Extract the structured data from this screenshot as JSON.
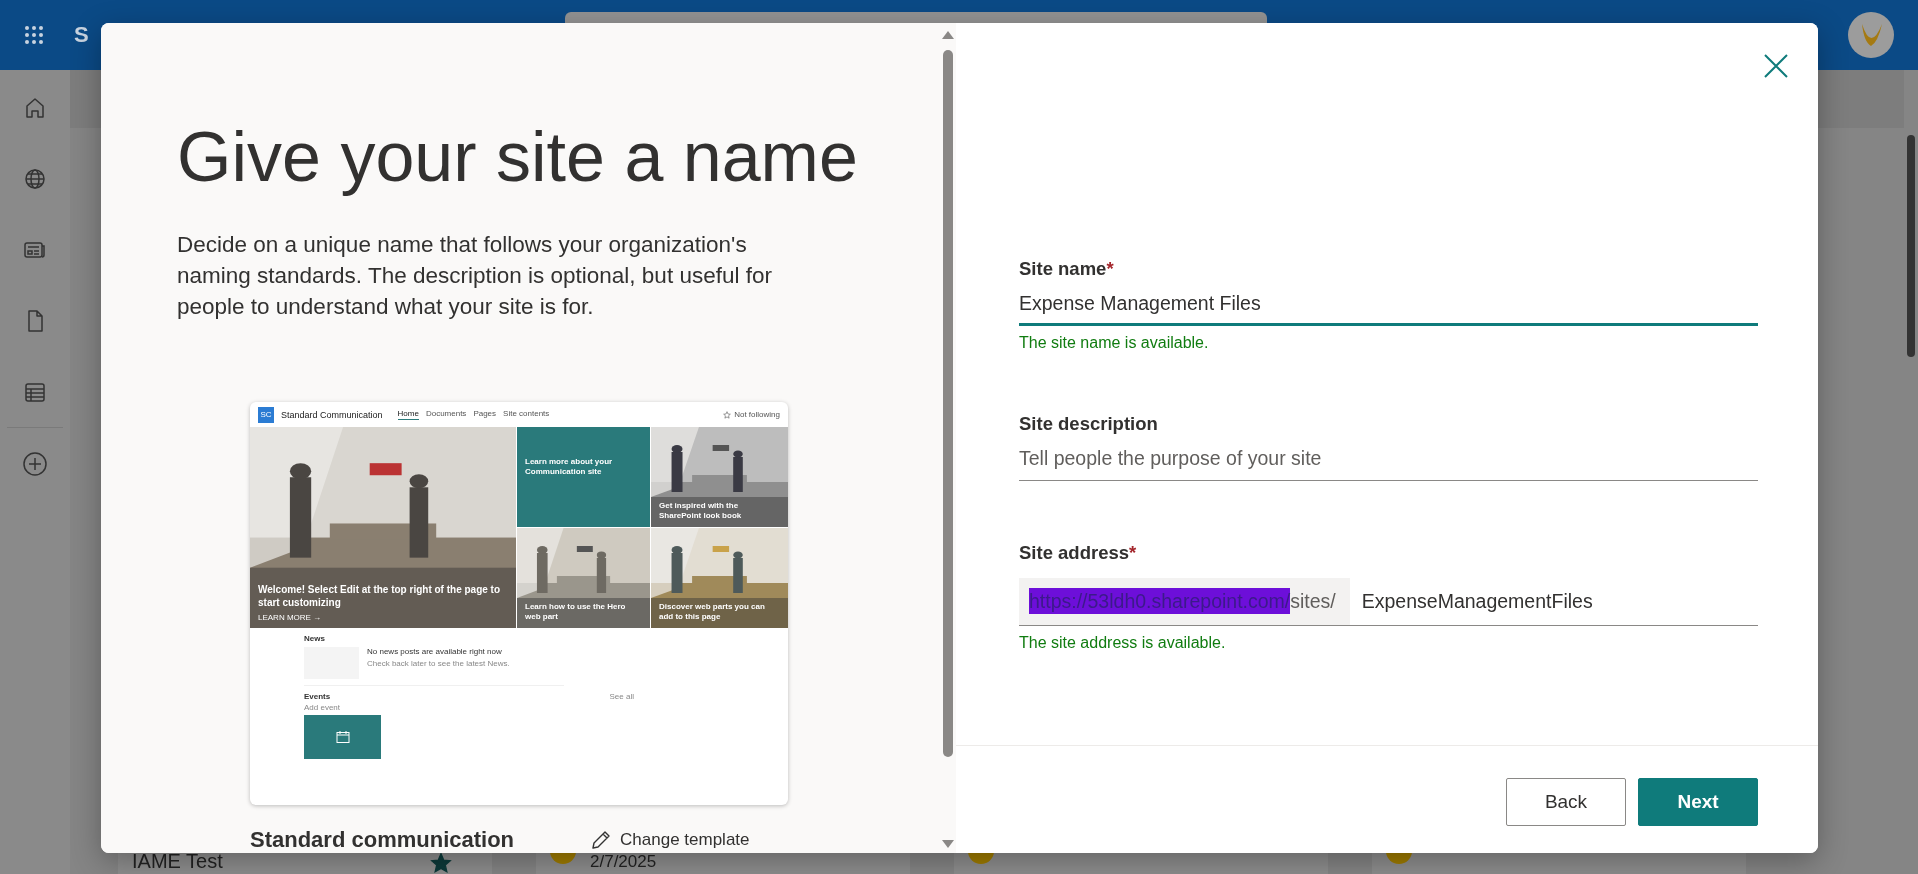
{
  "app_bar": {
    "title_fragment": "S"
  },
  "background_cards": [
    {
      "kind": "site",
      "title": "IAME Test",
      "starred": true
    },
    {
      "kind": "news",
      "date": "2/7/2025"
    },
    {
      "kind": "news"
    },
    {
      "kind": "news"
    }
  ],
  "dialog": {
    "title": "Give your site a name",
    "description": "Decide on a unique name that follows your organization's naming standards. The description is optional, but useful for people to understand what your site is for.",
    "template_preview": {
      "logo": "SC",
      "site_title": "Standard Communication",
      "nav": [
        {
          "label": "Home",
          "selected": true
        },
        {
          "label": "Documents",
          "selected": false
        },
        {
          "label": "Pages",
          "selected": false
        },
        {
          "label": "Site contents",
          "selected": false
        }
      ],
      "follow": "Not following",
      "hero": [
        {
          "text": "Welcome! Select Edit at the top right of the page to start customizing",
          "link": "LEARN MORE →"
        },
        {
          "kind": "color",
          "text": "Learn more about your Communication site"
        },
        {
          "text": "Get inspired with the SharePoint look book"
        },
        {
          "text": "Learn how to use the Hero web part"
        },
        {
          "text": "Discover web parts you can add to this page"
        }
      ],
      "news": {
        "heading": "News",
        "empty_title": "No news posts are available right now",
        "empty_text": "Check back later to see the latest News."
      },
      "events": {
        "heading": "Events",
        "add": "Add event",
        "see_all": "See all"
      }
    },
    "template_name": "Standard communication",
    "change_template": "Change template",
    "fields": [
      {
        "kind": "text",
        "label": "Site name",
        "required_mark": "*",
        "value": "Expense Management Files",
        "focused": true,
        "message": "The site name is available."
      },
      {
        "kind": "text",
        "label": "Site description",
        "placeholder": "Tell people the purpose of your site",
        "focused": false
      },
      {
        "kind": "address",
        "label": "Site address",
        "required_mark": "*",
        "prefix_host": "https://53ldh0.sharepoint.com/",
        "prefix_path": "sites/",
        "host_redacted": true,
        "value": "ExpenseManagementFiles",
        "focused": false,
        "message": "The site address is available."
      }
    ],
    "buttons": [
      {
        "kind": "secondary",
        "label": "Back"
      },
      {
        "kind": "primary",
        "label": "Next"
      }
    ]
  }
}
